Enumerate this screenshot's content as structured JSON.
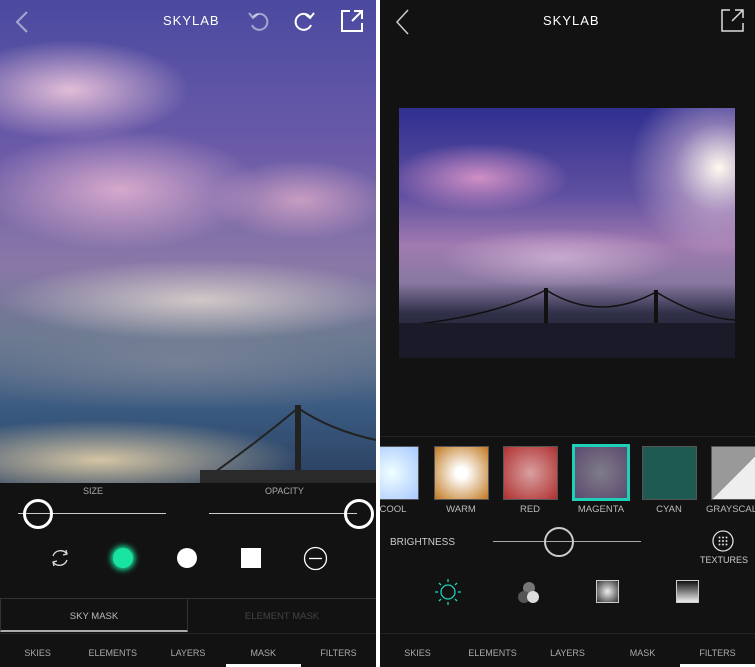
{
  "left": {
    "title": "SKYLAB",
    "size_label": "SIZE",
    "opacity_label": "OPACITY",
    "size_value": 0.1,
    "opacity_value": 1.0,
    "tools": [
      "rotate-icon",
      "soft-brush-icon",
      "hard-brush-icon",
      "square-brush-icon",
      "erase-icon"
    ],
    "accent": "#19e3a0",
    "mask_tabs": [
      {
        "label": "SKY MASK",
        "active": true
      },
      {
        "label": "ELEMENT MASK",
        "active": false
      }
    ],
    "nav": [
      {
        "label": "SKIES"
      },
      {
        "label": "ELEMENTS"
      },
      {
        "label": "LAYERS"
      },
      {
        "label": "MASK",
        "active": true
      },
      {
        "label": "FILTERS"
      }
    ]
  },
  "right": {
    "title": "SKYLAB",
    "filters": [
      {
        "label": "COOL",
        "color": "#cfe8ff"
      },
      {
        "label": "WARM",
        "color": "#c07820"
      },
      {
        "label": "RED",
        "color": "#c04848"
      },
      {
        "label": "MAGENTA",
        "color": "#6a5a78",
        "selected": true
      },
      {
        "label": "CYAN",
        "color": "#1e5a52"
      },
      {
        "label": "GRAYSCALE",
        "color": "#999999"
      }
    ],
    "brightness_label": "BRIGHTNESS",
    "brightness_value": 0.45,
    "textures_label": "TEXTURES",
    "accent": "#1fd0b8",
    "nav": [
      {
        "label": "SKIES"
      },
      {
        "label": "ELEMENTS"
      },
      {
        "label": "LAYERS"
      },
      {
        "label": "MASK"
      },
      {
        "label": "FILTERS",
        "active": true
      }
    ]
  }
}
